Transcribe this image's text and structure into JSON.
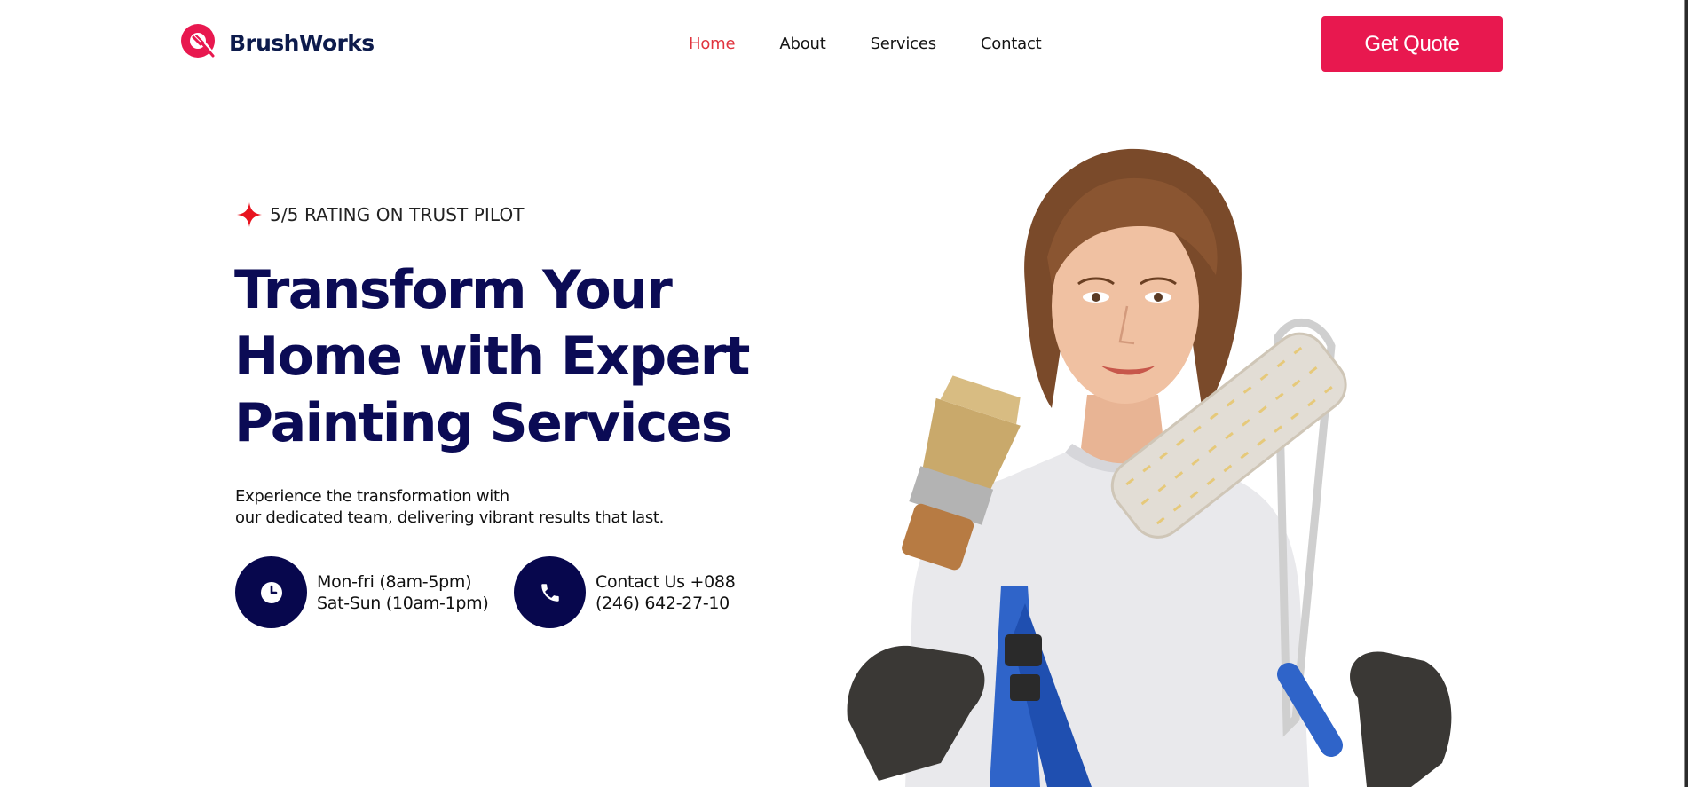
{
  "brand": {
    "name": "BrushWorks",
    "color": "#0d1b4c",
    "accent": "#e8184f"
  },
  "nav": {
    "items": [
      {
        "label": "Home",
        "active": true
      },
      {
        "label": "About",
        "active": false
      },
      {
        "label": "Services",
        "active": false
      },
      {
        "label": "Contact",
        "active": false
      }
    ],
    "active_color": "#e0343e"
  },
  "header": {
    "cta_label": "Get Quote"
  },
  "hero": {
    "rating_icon": "sparkle-star-icon",
    "rating_text": "5/5 RATING ON TRUST PILOT",
    "title_lines": [
      "Transform Your",
      "Home with Expert",
      "Painting Services"
    ],
    "description_lines": [
      "Experience the transformation with",
      "our dedicated team, delivering vibrant results that last."
    ],
    "title_color": "#0b0b55"
  },
  "info": {
    "hours": {
      "icon": "clock-icon",
      "line1": "Mon-fri (8am-5pm)",
      "line2": "Sat-Sun (10am-1pm)"
    },
    "contact": {
      "icon": "phone-icon",
      "line1": "Contact Us +088",
      "line2": "(246) 642-27-10"
    },
    "circle_color": "#07074d"
  },
  "image": {
    "subject": "painter-woman-with-brush-and-roller"
  }
}
